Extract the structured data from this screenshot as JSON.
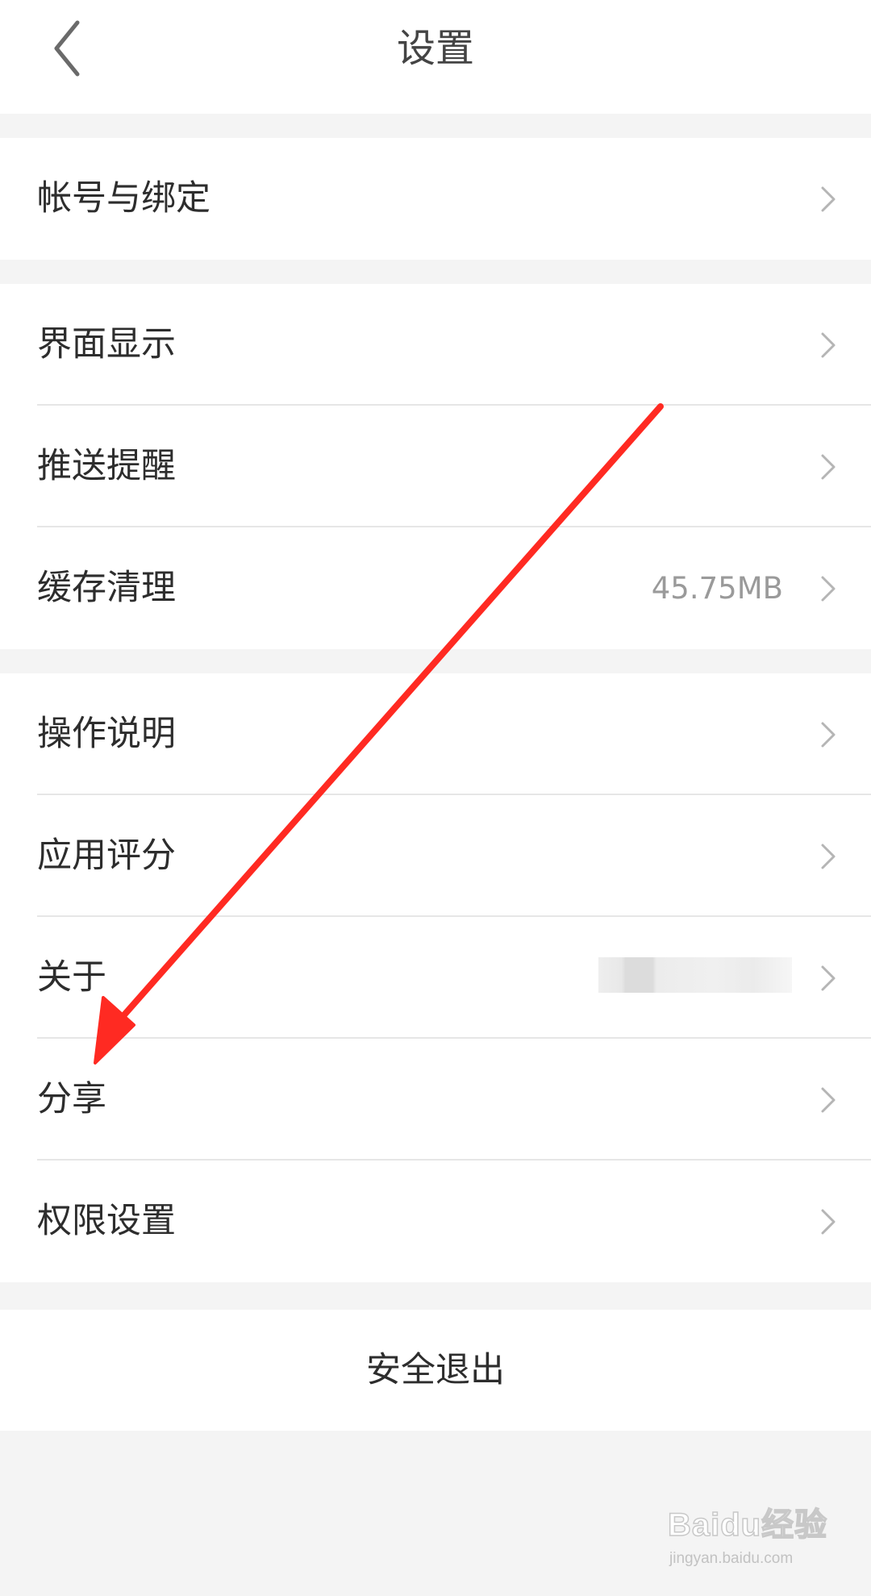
{
  "navbar": {
    "title": "设置",
    "back_icon": "chevron-left-icon"
  },
  "groups": [
    {
      "items": [
        {
          "label": "帐号与绑定"
        }
      ]
    },
    {
      "items": [
        {
          "label": "界面显示"
        },
        {
          "label": "推送提醒"
        },
        {
          "label": "缓存清理",
          "value": "45.75MB"
        }
      ]
    },
    {
      "items": [
        {
          "label": "操作说明"
        },
        {
          "label": "应用评分"
        },
        {
          "label": "关于",
          "value_redacted": true
        },
        {
          "label": "分享"
        },
        {
          "label": "权限设置"
        }
      ]
    }
  ],
  "logout": {
    "label": "安全退出"
  },
  "annotation": {
    "arrow_color": "#ff2a22",
    "points_to": "分享"
  },
  "watermark": {
    "brand": "Baidu经验",
    "url": "jingyan.baidu.com"
  },
  "colors": {
    "background": "#f4f4f4",
    "surface": "#ffffff",
    "divider": "#e6e6e6",
    "chevron": "#b5b5b5",
    "secondary_text": "#9a9a9a"
  }
}
